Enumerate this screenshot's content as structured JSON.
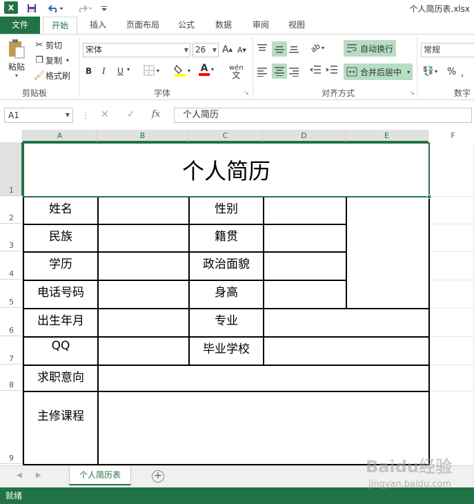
{
  "titlebar": {
    "logo": "X",
    "document_title": "个人简历表.xlsx",
    "save_icon": "save-icon",
    "undo_icon": "undo-icon",
    "redo_icon": "redo-icon"
  },
  "ribbon_tabs": [
    "文件",
    "开始",
    "插入",
    "页面布局",
    "公式",
    "数据",
    "审阅",
    "视图"
  ],
  "ribbon": {
    "clipboard": {
      "paste": "粘贴",
      "cut": "剪切",
      "copy": "复制",
      "format_painter": "格式刷",
      "group": "剪贴板"
    },
    "font": {
      "name": "宋体",
      "size": "26",
      "bold": "B",
      "italic": "I",
      "underline": "U",
      "wen": "wén",
      "group": "字体",
      "grow": "A",
      "shrink": "A"
    },
    "alignment": {
      "wrap_text": "自动换行",
      "merge_center": "合并后居中",
      "group": "对齐方式"
    },
    "number": {
      "format": "常规",
      "percent": "%",
      "group": "数字"
    },
    "colors": {
      "accent": "#217346",
      "highlight_fill": "#ffff00",
      "font_color": "#ff0000"
    }
  },
  "formula_bar": {
    "name_box": "A1",
    "fx": "fx",
    "cancel": "✕",
    "enter": "✓",
    "content": "个人简历"
  },
  "columns": [
    "A",
    "B",
    "C",
    "D",
    "E",
    "F"
  ],
  "rows": [
    "1",
    "2",
    "3",
    "4",
    "5",
    "6",
    "7",
    "8",
    "9"
  ],
  "sheet": {
    "title": "个人简历",
    "labels": {
      "name": "姓名",
      "gender": "性别",
      "ethnicity": "民族",
      "native_place": "籍贯",
      "education": "学历",
      "political_status": "政治面貌",
      "phone": "电话号码",
      "height": "身高",
      "birth": "出生年月",
      "major": "专业",
      "qq": "QQ",
      "school": "毕业学校",
      "job_intention": "求职意向",
      "courses": "主修课程"
    }
  },
  "sheet_tabs": {
    "active": "个人简历表",
    "add": "+"
  },
  "status_bar": {
    "text": "就绪"
  },
  "watermark": {
    "logo": "Baidu经验",
    "url": "jingyan.baidu.com"
  }
}
